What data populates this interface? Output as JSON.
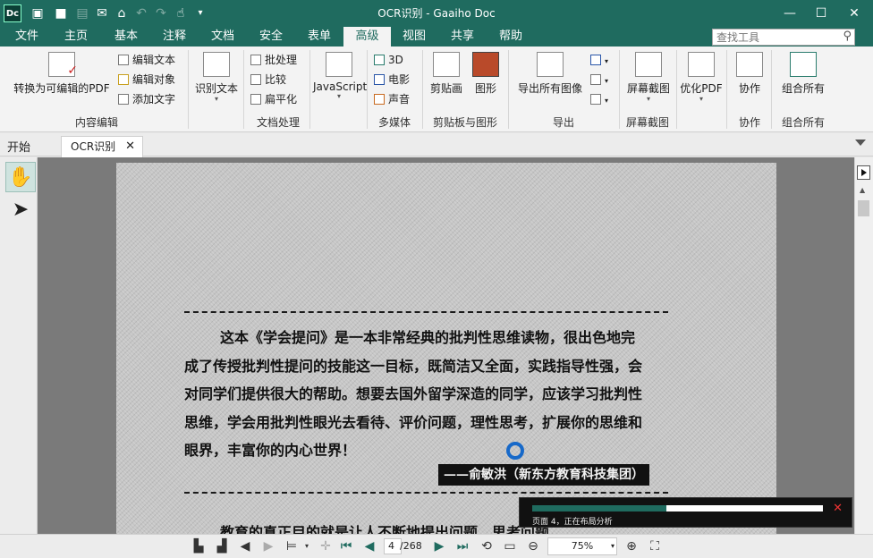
{
  "window": {
    "title": "OCR识别 - Gaaiho Doc",
    "app_icon": "Dc",
    "minimize": "—",
    "maximize": "☐",
    "close": "✕"
  },
  "quick_access": [
    "new-doc-icon",
    "open-folder-icon",
    "save-icon",
    "email-icon",
    "home-icon",
    "undo-icon",
    "redo-icon",
    "hand-pointer-icon",
    "customize-icon"
  ],
  "menu": {
    "tabs": [
      "文件",
      "主页",
      "基本",
      "注释",
      "文档",
      "安全",
      "表单",
      "高级",
      "视图",
      "共享",
      "帮助"
    ],
    "active_tab": "高级",
    "search_placeholder": "查找工具"
  },
  "ribbon": {
    "convert_editable": "转换为可编辑的PDF",
    "edit_text": "编辑文本",
    "edit_object": "编辑对象",
    "add_text": "添加文字",
    "group_content_edit": "内容编辑",
    "recognize_text": "识别文本",
    "batch": "批处理",
    "compare": "比较",
    "flatten": "扁平化",
    "group_doc_process": "文档处理",
    "javascript": "JavaScript",
    "three_d": "3D",
    "movie": "电影",
    "sound": "声音",
    "group_multimedia": "多媒体",
    "clip": "剪贴画",
    "shape": "图形",
    "group_clip_shape": "剪贴板与图形",
    "export_images": "导出所有图像",
    "group_export": "导出",
    "screenshot": "屏幕截图",
    "group_screenshot": "屏幕截图",
    "optimize_pdf": "优化PDF",
    "collaborate": "协作",
    "group_collaborate": "协作",
    "combine_all": "组合所有",
    "group_combine": "组合所有"
  },
  "tabs": {
    "start": "开始",
    "document": "OCR识别",
    "close": "✕"
  },
  "document": {
    "lines": [
      "这本《学会提问》是一本非常经典的批判性思维读物，很出色地完",
      "成了传授批判性提问的技能这一目标，既简洁又全面，实践指导性强，会",
      "对同学们提供很大的帮助。想要去国外留学深造的同学，应该学习批判性",
      "思维，学会用批判性眼光去看待、评价问题，理性思考，扩展你的思维和",
      "眼界，丰富你的内心世界！"
    ],
    "attribution": "——俞敏洪（新东方教育科技集团）",
    "bottom_text": "教育的真正目的就是让人不断地提出问题、思考问题。"
  },
  "progress": {
    "text": "页面 4，正在布局分析",
    "fraction": 0.46
  },
  "statusbar": {
    "current_page": "4",
    "total_pages": "/268",
    "zoom": "75%"
  },
  "colors": {
    "accent": "#1f6b5f",
    "busy_indicator": "#1769c9"
  }
}
